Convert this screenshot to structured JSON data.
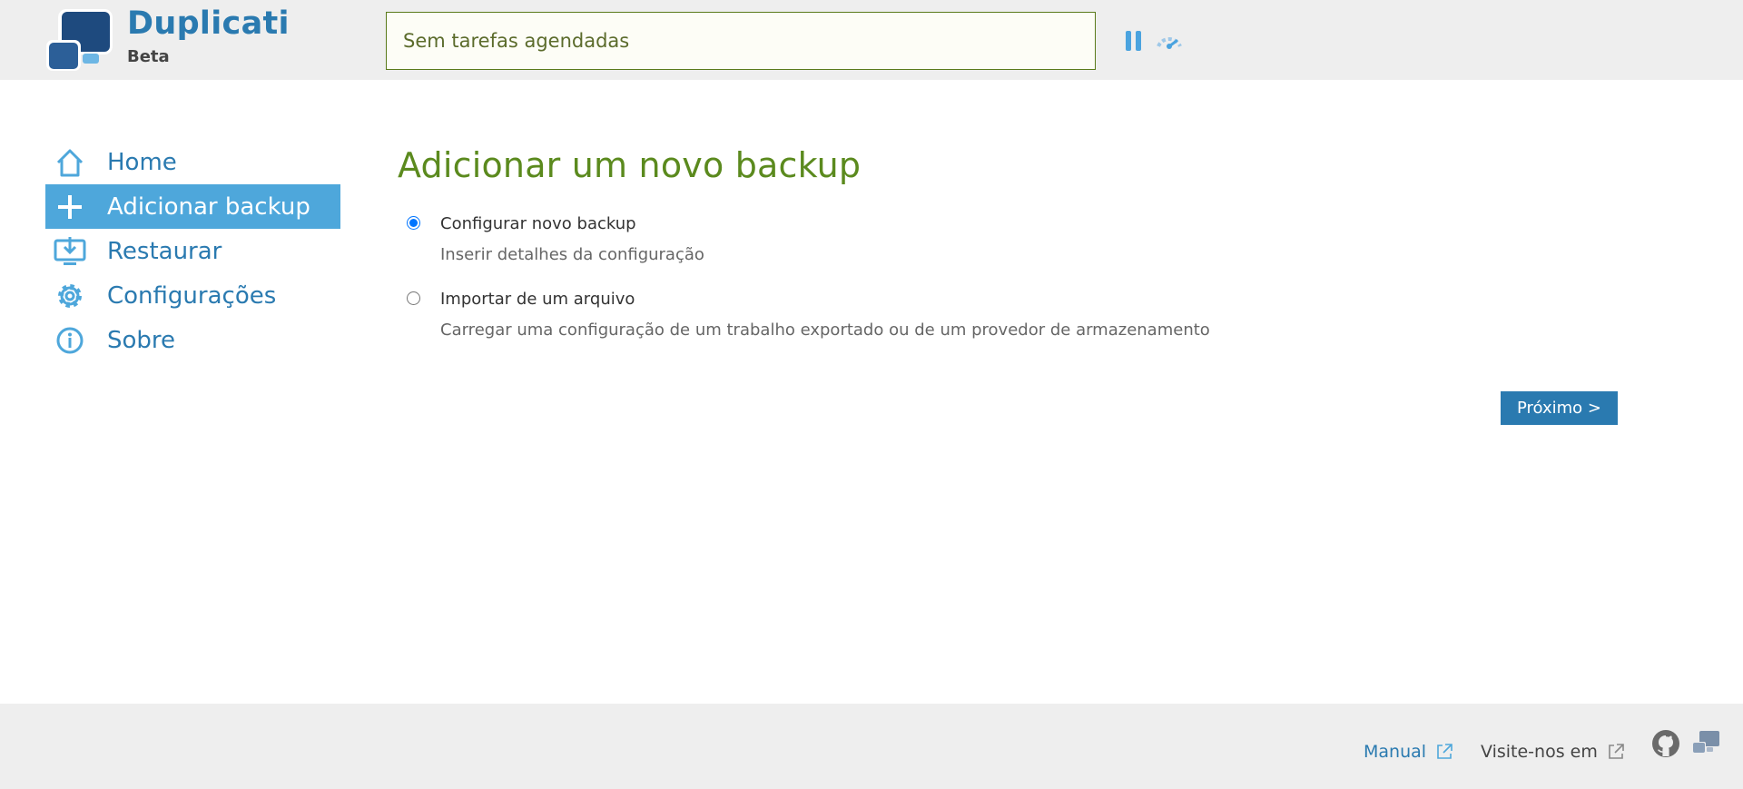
{
  "app": {
    "name": "Duplicati",
    "edition": "Beta"
  },
  "status": {
    "text": "Sem tarefas agendadas"
  },
  "sidebar": {
    "items": [
      {
        "label": "Home",
        "icon": "home-icon",
        "active": false
      },
      {
        "label": "Adicionar backup",
        "icon": "plus-icon",
        "active": true
      },
      {
        "label": "Restaurar",
        "icon": "restore-icon",
        "active": false
      },
      {
        "label": "Configurações",
        "icon": "gear-icon",
        "active": false
      },
      {
        "label": "Sobre",
        "icon": "info-icon",
        "active": false
      }
    ]
  },
  "main": {
    "title": "Adicionar um novo backup",
    "options": [
      {
        "title": "Configurar novo backup",
        "description": "Inserir detalhes da configuração",
        "selected": true
      },
      {
        "title": "Importar de um arquivo",
        "description": "Carregar uma configuração de um trabalho exportado ou de um provedor de armazenamento",
        "selected": false
      }
    ],
    "next_label": "Próximo >"
  },
  "footer": {
    "manual_label": "Manual",
    "visit_label": "Visite-nos em"
  },
  "colors": {
    "accent": "#2a7ab0",
    "active_nav": "#4ea7db",
    "title_green": "#5b8a1e",
    "bar_bg": "#eeeeee"
  }
}
